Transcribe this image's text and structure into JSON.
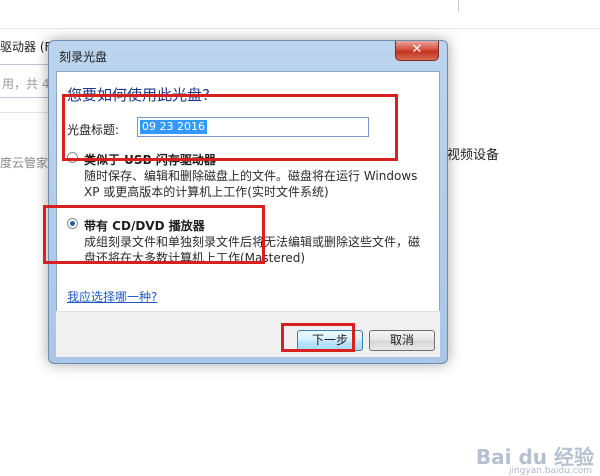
{
  "background": {
    "drive_label": "驱动器 (F:",
    "used_text": "用，共 4",
    "cloud_text": "度云管家",
    "video_text": "视频设备"
  },
  "dialog": {
    "title": "刻录光盘",
    "close_glyph": "✕",
    "question": "您要如何使用此光盘?",
    "disc_title_label": "光盘标题:",
    "disc_title_value": "09 23 2016",
    "option_usb": {
      "label": "类似于 USB 闪存驱动器",
      "description": "随时保存、编辑和删除磁盘上的文件。磁盘将在运行 Windows XP 或更高版本的计算机上工作(实时文件系统)",
      "selected": false
    },
    "option_cd": {
      "label": "带有 CD/DVD 播放器",
      "description": "成组刻录文件和单独刻录文件后将无法编辑或删除这些文件，磁盘还将在大多数计算机上工作(Mastered)",
      "selected": true
    },
    "help_link": "我应选择哪一种?",
    "next_button": "下一步",
    "cancel_button": "取消"
  },
  "watermark": {
    "brand": "Bai du 经验",
    "sub": "jingyan.baidu.com"
  },
  "colors": {
    "highlight": "#d6211f",
    "question_text": "#1d3a8a",
    "link": "#1e5bc6"
  }
}
